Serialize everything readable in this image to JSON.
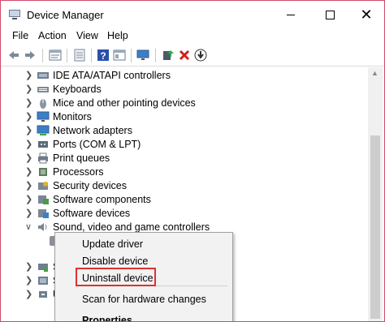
{
  "window": {
    "title": "Device Manager"
  },
  "window_controls": {
    "minimize_icon": "minimize-icon",
    "maximize_icon": "maximize-icon",
    "close_glyph": "✕"
  },
  "menu": {
    "items": [
      "File",
      "Action",
      "View",
      "Help"
    ]
  },
  "toolbar": {
    "icons": [
      "back-arrow-icon",
      "forward-arrow-icon",
      "properties-icon",
      "show-hidden-icon",
      "help-icon",
      "details-icon",
      "scan-monitor-icon",
      "update-driver-icon",
      "uninstall-x-icon",
      "download-icon"
    ]
  },
  "tree": {
    "items": [
      {
        "label": "IDE ATA/ATAPI controllers",
        "icon": "ide-controller-icon"
      },
      {
        "label": "Keyboards",
        "icon": "keyboard-icon"
      },
      {
        "label": "Mice and other pointing devices",
        "icon": "mouse-icon"
      },
      {
        "label": "Monitors",
        "icon": "monitor-icon"
      },
      {
        "label": "Network adapters",
        "icon": "network-adapter-icon"
      },
      {
        "label": "Ports (COM & LPT)",
        "icon": "port-icon"
      },
      {
        "label": "Print queues",
        "icon": "printer-icon"
      },
      {
        "label": "Processors",
        "icon": "processor-icon"
      },
      {
        "label": "Security devices",
        "icon": "security-device-icon"
      },
      {
        "label": "Software components",
        "icon": "software-component-icon"
      },
      {
        "label": "Software devices",
        "icon": "software-device-icon"
      },
      {
        "label": "Sound, video and game controllers",
        "icon": "sound-icon",
        "expanded": true
      }
    ],
    "partial_rows": [
      "S",
      "S",
      "U"
    ]
  },
  "context_menu": {
    "items": [
      "Update driver",
      "Disable device",
      "Uninstall device",
      "Scan for hardware changes",
      "Properties"
    ],
    "highlighted": "Uninstall device",
    "highlight_color": "#e03030"
  }
}
